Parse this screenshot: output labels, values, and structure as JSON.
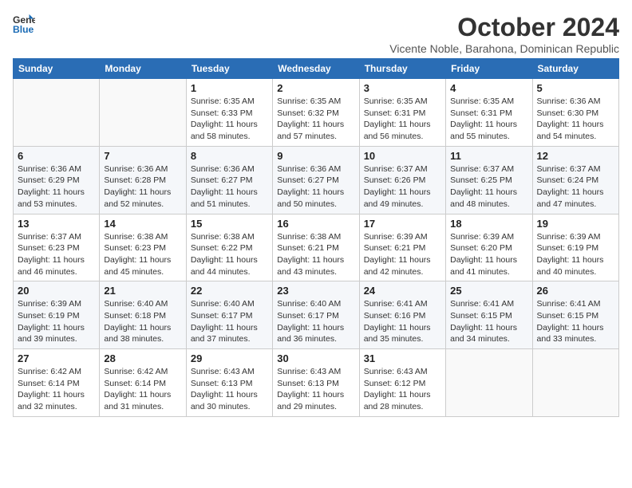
{
  "logo": {
    "line1": "General",
    "line2": "Blue"
  },
  "title": "October 2024",
  "subtitle": "Vicente Noble, Barahona, Dominican Republic",
  "days_of_week": [
    "Sunday",
    "Monday",
    "Tuesday",
    "Wednesday",
    "Thursday",
    "Friday",
    "Saturday"
  ],
  "weeks": [
    [
      {
        "day": "",
        "info": ""
      },
      {
        "day": "",
        "info": ""
      },
      {
        "day": "1",
        "info": "Sunrise: 6:35 AM\nSunset: 6:33 PM\nDaylight: 11 hours and 58 minutes."
      },
      {
        "day": "2",
        "info": "Sunrise: 6:35 AM\nSunset: 6:32 PM\nDaylight: 11 hours and 57 minutes."
      },
      {
        "day": "3",
        "info": "Sunrise: 6:35 AM\nSunset: 6:31 PM\nDaylight: 11 hours and 56 minutes."
      },
      {
        "day": "4",
        "info": "Sunrise: 6:35 AM\nSunset: 6:31 PM\nDaylight: 11 hours and 55 minutes."
      },
      {
        "day": "5",
        "info": "Sunrise: 6:36 AM\nSunset: 6:30 PM\nDaylight: 11 hours and 54 minutes."
      }
    ],
    [
      {
        "day": "6",
        "info": "Sunrise: 6:36 AM\nSunset: 6:29 PM\nDaylight: 11 hours and 53 minutes."
      },
      {
        "day": "7",
        "info": "Sunrise: 6:36 AM\nSunset: 6:28 PM\nDaylight: 11 hours and 52 minutes."
      },
      {
        "day": "8",
        "info": "Sunrise: 6:36 AM\nSunset: 6:27 PM\nDaylight: 11 hours and 51 minutes."
      },
      {
        "day": "9",
        "info": "Sunrise: 6:36 AM\nSunset: 6:27 PM\nDaylight: 11 hours and 50 minutes."
      },
      {
        "day": "10",
        "info": "Sunrise: 6:37 AM\nSunset: 6:26 PM\nDaylight: 11 hours and 49 minutes."
      },
      {
        "day": "11",
        "info": "Sunrise: 6:37 AM\nSunset: 6:25 PM\nDaylight: 11 hours and 48 minutes."
      },
      {
        "day": "12",
        "info": "Sunrise: 6:37 AM\nSunset: 6:24 PM\nDaylight: 11 hours and 47 minutes."
      }
    ],
    [
      {
        "day": "13",
        "info": "Sunrise: 6:37 AM\nSunset: 6:23 PM\nDaylight: 11 hours and 46 minutes."
      },
      {
        "day": "14",
        "info": "Sunrise: 6:38 AM\nSunset: 6:23 PM\nDaylight: 11 hours and 45 minutes."
      },
      {
        "day": "15",
        "info": "Sunrise: 6:38 AM\nSunset: 6:22 PM\nDaylight: 11 hours and 44 minutes."
      },
      {
        "day": "16",
        "info": "Sunrise: 6:38 AM\nSunset: 6:21 PM\nDaylight: 11 hours and 43 minutes."
      },
      {
        "day": "17",
        "info": "Sunrise: 6:39 AM\nSunset: 6:21 PM\nDaylight: 11 hours and 42 minutes."
      },
      {
        "day": "18",
        "info": "Sunrise: 6:39 AM\nSunset: 6:20 PM\nDaylight: 11 hours and 41 minutes."
      },
      {
        "day": "19",
        "info": "Sunrise: 6:39 AM\nSunset: 6:19 PM\nDaylight: 11 hours and 40 minutes."
      }
    ],
    [
      {
        "day": "20",
        "info": "Sunrise: 6:39 AM\nSunset: 6:19 PM\nDaylight: 11 hours and 39 minutes."
      },
      {
        "day": "21",
        "info": "Sunrise: 6:40 AM\nSunset: 6:18 PM\nDaylight: 11 hours and 38 minutes."
      },
      {
        "day": "22",
        "info": "Sunrise: 6:40 AM\nSunset: 6:17 PM\nDaylight: 11 hours and 37 minutes."
      },
      {
        "day": "23",
        "info": "Sunrise: 6:40 AM\nSunset: 6:17 PM\nDaylight: 11 hours and 36 minutes."
      },
      {
        "day": "24",
        "info": "Sunrise: 6:41 AM\nSunset: 6:16 PM\nDaylight: 11 hours and 35 minutes."
      },
      {
        "day": "25",
        "info": "Sunrise: 6:41 AM\nSunset: 6:15 PM\nDaylight: 11 hours and 34 minutes."
      },
      {
        "day": "26",
        "info": "Sunrise: 6:41 AM\nSunset: 6:15 PM\nDaylight: 11 hours and 33 minutes."
      }
    ],
    [
      {
        "day": "27",
        "info": "Sunrise: 6:42 AM\nSunset: 6:14 PM\nDaylight: 11 hours and 32 minutes."
      },
      {
        "day": "28",
        "info": "Sunrise: 6:42 AM\nSunset: 6:14 PM\nDaylight: 11 hours and 31 minutes."
      },
      {
        "day": "29",
        "info": "Sunrise: 6:43 AM\nSunset: 6:13 PM\nDaylight: 11 hours and 30 minutes."
      },
      {
        "day": "30",
        "info": "Sunrise: 6:43 AM\nSunset: 6:13 PM\nDaylight: 11 hours and 29 minutes."
      },
      {
        "day": "31",
        "info": "Sunrise: 6:43 AM\nSunset: 6:12 PM\nDaylight: 11 hours and 28 minutes."
      },
      {
        "day": "",
        "info": ""
      },
      {
        "day": "",
        "info": ""
      }
    ]
  ]
}
